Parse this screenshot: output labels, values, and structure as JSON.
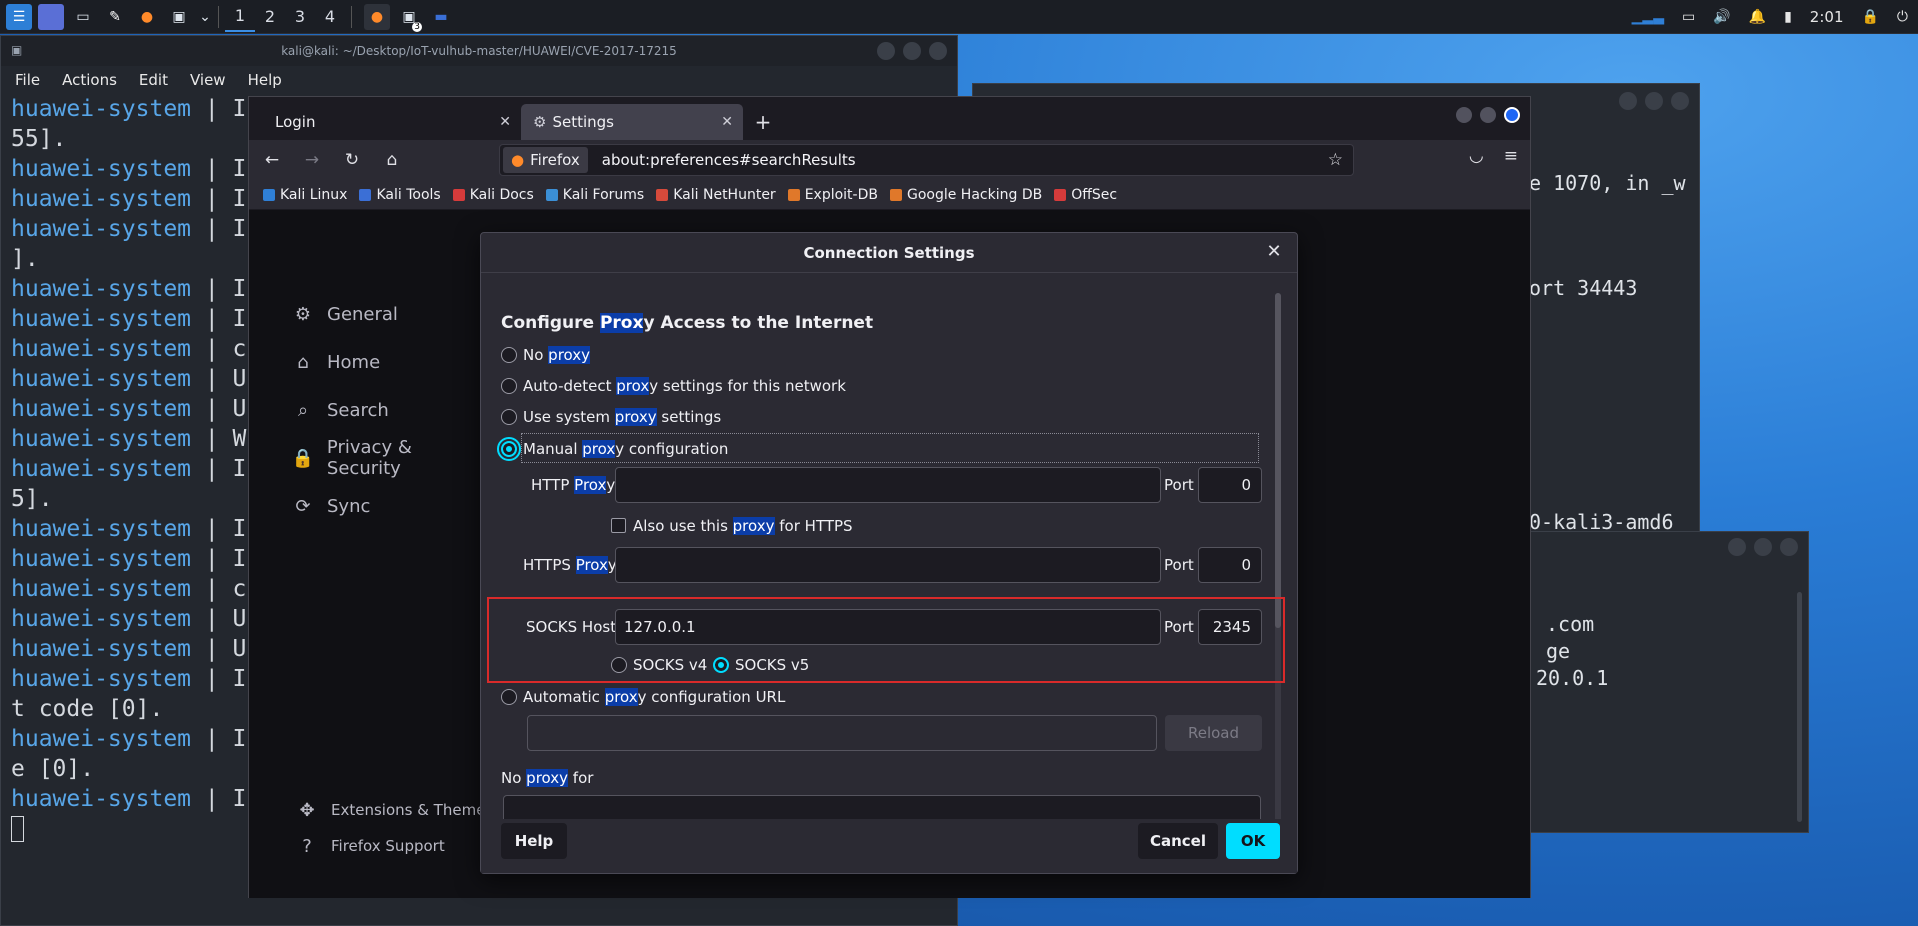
{
  "taskbar": {
    "workspaces": [
      "1",
      "2",
      "3",
      "4"
    ],
    "clock": "2:01",
    "badge": "3"
  },
  "terminal": {
    "title": "kali@kali: ~/Desktop/IoT-vulhub-master/HUAWEI/CVE-2017-17215",
    "menu": [
      "File",
      "Actions",
      "Edit",
      "View",
      "Help"
    ],
    "lines": [
      {
        "host": "huawei-system",
        "rest": " | I"
      },
      {
        "host": "",
        "rest": "55]."
      },
      {
        "host": "huawei-system",
        "rest": " | I"
      },
      {
        "host": "huawei-system",
        "rest": " | I"
      },
      {
        "host": "huawei-system",
        "rest": " | I"
      },
      {
        "host": "",
        "rest": "]."
      },
      {
        "host": "huawei-system",
        "rest": " | I"
      },
      {
        "host": "huawei-system",
        "rest": " | I"
      },
      {
        "host": "huawei-system",
        "rest": " | c"
      },
      {
        "host": "huawei-system",
        "rest": " | U"
      },
      {
        "host": "huawei-system",
        "rest": " | U"
      },
      {
        "host": "huawei-system",
        "rest": " | W"
      },
      {
        "host": "huawei-system",
        "rest": " | I"
      },
      {
        "host": "",
        "rest": "5]."
      },
      {
        "host": "huawei-system",
        "rest": " | I"
      },
      {
        "host": "huawei-system",
        "rest": " | I"
      },
      {
        "host": "huawei-system",
        "rest": " | c"
      },
      {
        "host": "huawei-system",
        "rest": " | U"
      },
      {
        "host": "huawei-system",
        "rest": " | U"
      },
      {
        "host": "huawei-system",
        "rest": " | I"
      },
      {
        "host": "",
        "rest": "t code [0]."
      },
      {
        "host": "huawei-system",
        "rest": " | I"
      },
      {
        "host": "",
        "rest": "e [0]."
      },
      {
        "host": "huawei-system",
        "rest": " | I"
      }
    ]
  },
  "bg_terminal_1": {
    "lines": [
      "e 1070, in _w",
      "ort 34443",
      "0-kali3-amd6"
    ]
  },
  "bg_terminal_2": {
    "lines": [
      ".com",
      "ge",
      "20.0.1"
    ]
  },
  "firefox": {
    "tabs": [
      {
        "label": "Login"
      },
      {
        "label": "Settings"
      }
    ],
    "identity": "Firefox",
    "url": "about:preferences#searchResults",
    "bookmarks": [
      {
        "label": "Kali Linux",
        "color": "#2f7fd6"
      },
      {
        "label": "Kali Tools",
        "color": "#3b6fd6"
      },
      {
        "label": "Kali Docs",
        "color": "#d63b3b"
      },
      {
        "label": "Kali Forums",
        "color": "#3b8fd6"
      },
      {
        "label": "Kali NetHunter",
        "color": "#d64a3b"
      },
      {
        "label": "Exploit-DB",
        "color": "#e0782a"
      },
      {
        "label": "Google Hacking DB",
        "color": "#e0782a"
      },
      {
        "label": "OffSec",
        "color": "#d63b3b"
      }
    ],
    "sidebar": [
      {
        "label": "General"
      },
      {
        "label": "Home"
      },
      {
        "label": "Search"
      },
      {
        "label": "Privacy & Security"
      },
      {
        "label": "Sync"
      }
    ],
    "sidebar_bottom": [
      {
        "label": "Extensions & Themes"
      },
      {
        "label": "Firefox Support"
      }
    ]
  },
  "dialog": {
    "title": "Connection Settings",
    "heading_pre": "Configure ",
    "heading_hl": "Prox",
    "heading_post": "y Access to the Internet",
    "options": {
      "no_proxy": {
        "pre": "No ",
        "hl": "proxy",
        "post": ""
      },
      "auto_detect": {
        "pre": "Auto-detect ",
        "hl": "prox",
        "post": "y settings for this network"
      },
      "system": {
        "pre": "Use system ",
        "hl": "proxy",
        "post": " settings"
      },
      "manual": {
        "pre": "Manual ",
        "hl": "prox",
        "post": "y configuration"
      },
      "auto_url": {
        "pre": "Automatic ",
        "hl": "prox",
        "post": "y configuration URL"
      }
    },
    "selected_option": "manual",
    "http": {
      "pre": "HTTP ",
      "hl": "Prox",
      "post": "y",
      "value": "",
      "port_label": "Port",
      "port": "0"
    },
    "also_https": {
      "pre": "Also use this ",
      "hl": "proxy",
      "post": " for HTTPS",
      "checked": false
    },
    "https": {
      "pre": "HTTPS ",
      "hl": "Prox",
      "post": "y",
      "value": "",
      "port_label": "Port",
      "port": "0"
    },
    "socks": {
      "label": "SOCKS Host",
      "value": "127.0.0.1",
      "port_label": "Port",
      "port": "2345",
      "v4": "SOCKS v4",
      "v5": "SOCKS v5",
      "selected": "v5"
    },
    "reload": "Reload",
    "no_proxy_for": {
      "pre": "No ",
      "hl": "proxy",
      "post": " for"
    },
    "buttons": {
      "help": "Help",
      "cancel": "Cancel",
      "ok": "OK"
    },
    "colors": {
      "accent": "#00ddff",
      "highlight": "#0b3da8",
      "annotation": "#d92a2a"
    }
  }
}
